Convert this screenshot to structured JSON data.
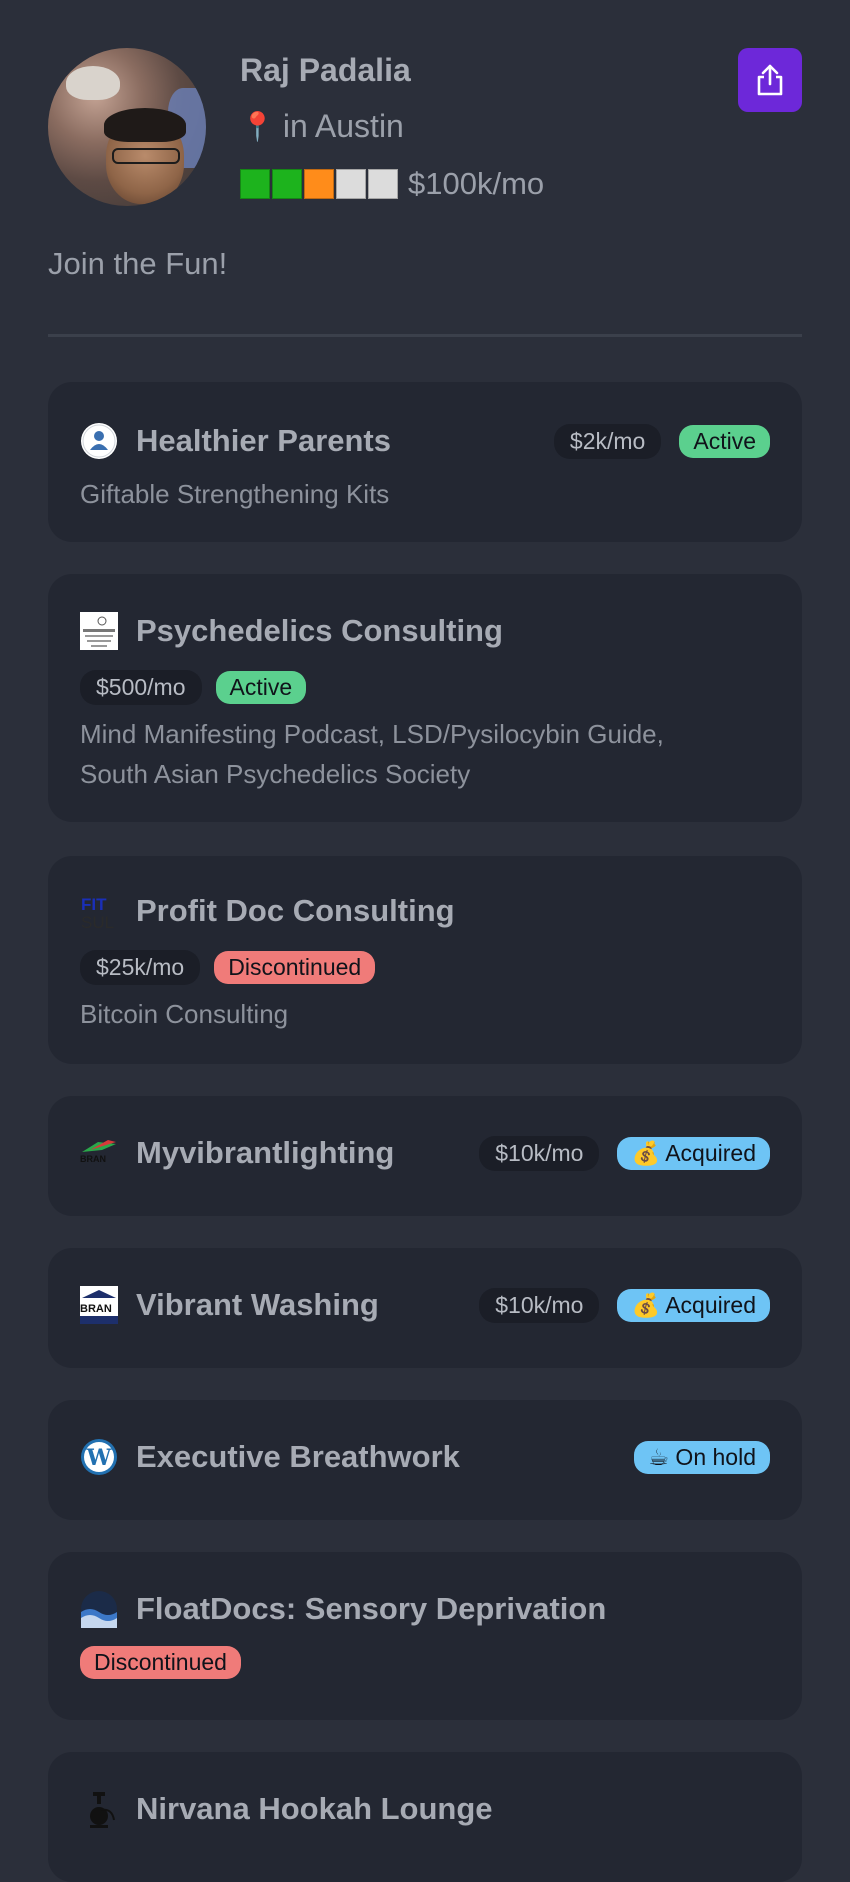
{
  "profile": {
    "name": "Raj Padalia",
    "location": "in Austin",
    "revenue": "$100k/mo",
    "revenue_bar": [
      "#1db31d",
      "#1db31d",
      "#ff8c1a",
      "#dcdcdc",
      "#dcdcdc"
    ],
    "tagline": "Join the Fun!"
  },
  "colors": {
    "background": "#2b2f3a",
    "card": "#232732",
    "share_button": "#6d28d9",
    "active": "#5bd08e",
    "discontinued": "#f07b79",
    "acquired": "#6ec4f5"
  },
  "projects": [
    {
      "title": "Healthier Parents",
      "mrr": "$2k/mo",
      "status": "Active",
      "description": "Giftable Strengthening Kits",
      "icon": "healthier-parents-logo"
    },
    {
      "title": "Psychedelics Consulting",
      "mrr": "$500/mo",
      "status": "Active",
      "description_lines": [
        "Mind Manifesting Podcast, LSD/Pysilocybin Guide,",
        "South Asian Psychedelics Society"
      ],
      "icon": "psychedelics-logo"
    },
    {
      "title": "Profit Doc Consulting",
      "mrr": "$25k/mo",
      "status": "Discontinued",
      "description": "Bitcoin Consulting",
      "icon": "profit-doc-logo"
    },
    {
      "title": "Myvibrantlighting",
      "mrr": "$10k/mo",
      "status": "💰 Acquired",
      "icon": "vibrant-lighting-logo"
    },
    {
      "title": "Vibrant Washing",
      "mrr": "$10k/mo",
      "status": "💰 Acquired",
      "icon": "vibrant-washing-logo"
    },
    {
      "title": "Executive Breathwork",
      "status": "☕ On hold",
      "icon": "wordpress-icon"
    },
    {
      "title": "FloatDocs: Sensory Deprivation",
      "status": "Discontinued",
      "icon": "floatdocs-logo"
    },
    {
      "title": "Nirvana Hookah Lounge",
      "icon": "hookah-icon"
    }
  ]
}
